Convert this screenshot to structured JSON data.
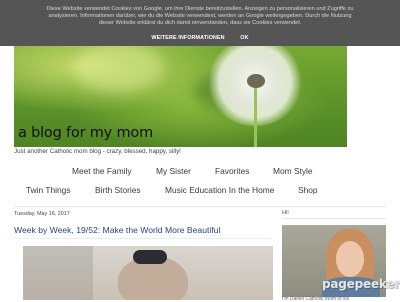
{
  "cookie_banner": {
    "text": "Diese Website verwendet Cookies von Google, um ihre Dienste bereitzustellen. Anzeigen zu personalisieren und Zugriffe zu analysieren. Informationen darüber, wie du die Website verwendest, werden an Google weitergegeben. Durch die Nutzung dieser Website erklärst du dich damit einverstanden, dass sie Cookies verwendet.",
    "more_info_label": "WEITERE INFORMATIONEN",
    "ok_label": "OK"
  },
  "header": {
    "blog_title": "a blog for my mom",
    "tagline": "Just another Catholic mom blog - crazy, blessed, happy, silly!"
  },
  "nav": {
    "row1": [
      "Meet the Family",
      "My Sister",
      "Favorites",
      "Mom Style"
    ],
    "row2": [
      "Twin Things",
      "Birth Stories",
      "Music Education In the Home",
      "Shop"
    ]
  },
  "post": {
    "date": "Tuesday, May 16, 2017",
    "title": "Week by Week, 19/52: Make the World More Beautiful"
  },
  "sidebar": {
    "heading": "Hi!",
    "caption": "I'm Daniel Catholic mom of six"
  },
  "watermark": "pagepeeker"
}
